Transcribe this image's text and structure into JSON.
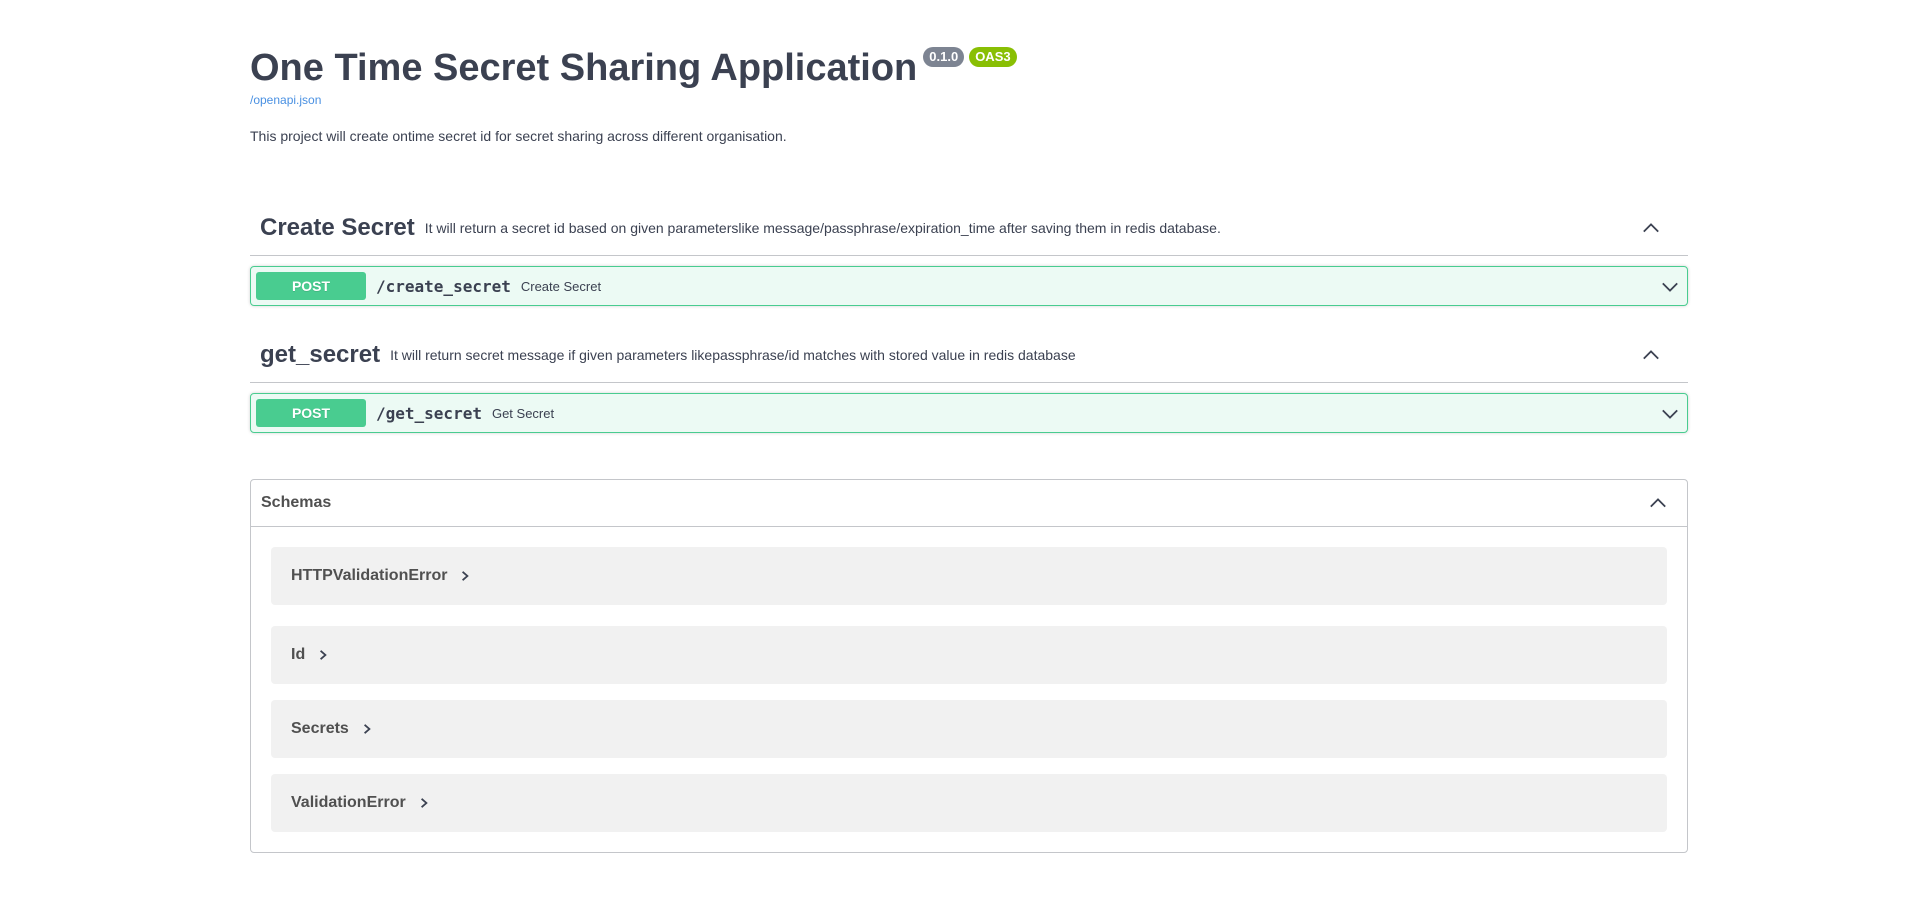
{
  "info": {
    "title": "One Time Secret Sharing Application",
    "version": "0.1.0",
    "oas_badge": "OAS3",
    "spec_link": "/openapi.json",
    "description": "This project will create ontime secret id for secret sharing across different organisation."
  },
  "tags": [
    {
      "name": "Create Secret",
      "description": "It will return a secret id based on given parameterslike message/passphrase/expiration_time after saving them in redis database.",
      "operation": {
        "method": "POST",
        "path": "/create_secret",
        "summary": "Create Secret"
      }
    },
    {
      "name": "get_secret",
      "description": "It will return secret message if given parameters likepassphrase/id matches with stored value in redis database",
      "operation": {
        "method": "POST",
        "path": "/get_secret",
        "summary": "Get Secret"
      }
    }
  ],
  "schemas": {
    "title": "Schemas",
    "items": [
      "HTTPValidationError",
      "Id",
      "Secrets",
      "ValidationError"
    ]
  },
  "colors": {
    "post": "#49cc90",
    "version_badge": "#7d8492",
    "oas_badge": "#89bf04",
    "link": "#4990e2"
  }
}
